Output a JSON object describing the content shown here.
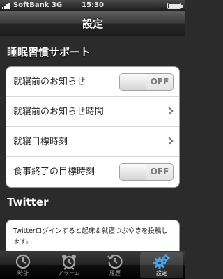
{
  "status_bar": {
    "carrier": "SoftBank",
    "network": "3G",
    "time": "15:30"
  },
  "nav": {
    "title": "設定"
  },
  "sleep_section": {
    "header": "睡眠習慣サポート",
    "rows": [
      {
        "label": "就寝前のお知らせ",
        "control": "toggle",
        "value": "OFF"
      },
      {
        "label": "就寝前のお知らせ時間",
        "control": "chevron"
      },
      {
        "label": "就寝目標時刻",
        "control": "chevron"
      },
      {
        "label": "食事終了の目標時刻",
        "control": "toggle",
        "value": "OFF"
      }
    ]
  },
  "twitter_section": {
    "header": "Twitter",
    "note": "Twitterログインすると起床＆就寝つぶやきを投稿します。"
  },
  "tab_bar": {
    "tabs": [
      {
        "label": "時計",
        "icon": "clock-icon"
      },
      {
        "label": "アラーム",
        "icon": "alarm-icon"
      },
      {
        "label": "履歴",
        "icon": "history-icon"
      },
      {
        "label": "設定",
        "icon": "gear-icon",
        "active": true
      }
    ]
  },
  "colors": {
    "tab_active_icon": "#4aa3e8",
    "background": "#2b2b2b"
  }
}
